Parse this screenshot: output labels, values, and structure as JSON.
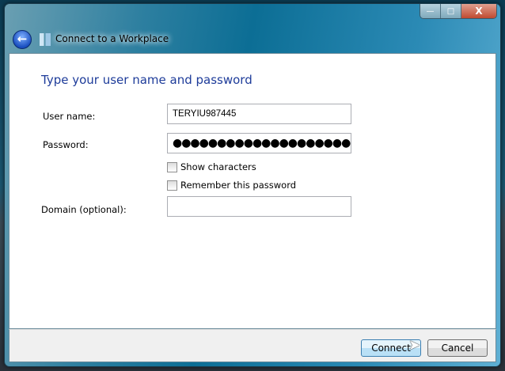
{
  "window": {
    "title": "Connect to a Workplace",
    "minimize": "—",
    "maximize": "□",
    "close": "X"
  },
  "heading": "Type your user name and password",
  "form": {
    "username_label": "User name:",
    "username_value": "TERYIU987445",
    "password_label": "Password:",
    "password_value": "●●●●●●●●●●●●●●●●●●●●",
    "show_characters": "Show characters",
    "remember_password": "Remember this password",
    "domain_label": "Domain (optional):",
    "domain_value": ""
  },
  "buttons": {
    "connect": "Connect",
    "cancel": "Cancel"
  }
}
